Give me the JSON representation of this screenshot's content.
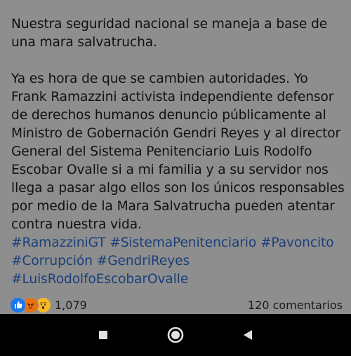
{
  "post": {
    "paragraph1": "Nuestra seguridad nacional se maneja a base de una mara salvatrucha.",
    "paragraph2": "Ya es hora de que se cambien autoridades. Yo Frank Ramazzini activista independiente defensor de derechos humanos denuncio públicamente al Ministro de Gobernación Gendri Reyes y al director General del Sistema Penitenciario Luis Rodolfo Escobar Ovalle si a mi familia y a su servidor nos llega a pasar algo ellos son los únicos responsables por medio de la Mara Salvatrucha pueden atentar contra nuestra vida.",
    "hashtags": [
      "#RamazziniGT",
      "#SistemaPenitenciario",
      "#Pavoncito",
      "#Corrupción",
      "#GendriReyes",
      "#LuisRodolfoEscobarOvalle"
    ]
  },
  "reactions": {
    "icons": [
      "like-icon",
      "angry-icon",
      "wow-icon"
    ],
    "count": "1,079",
    "comments": "120 comentarios"
  },
  "navigation": {
    "buttons": [
      "recents-button",
      "home-button",
      "back-button"
    ]
  },
  "colors": {
    "background": "#8e8e8e",
    "text": "#111111",
    "hashtag": "#1a3f7a",
    "nav_bar": "#000000",
    "like": "#1877f2",
    "angry": "#e9710f",
    "wow": "#f7b928"
  }
}
